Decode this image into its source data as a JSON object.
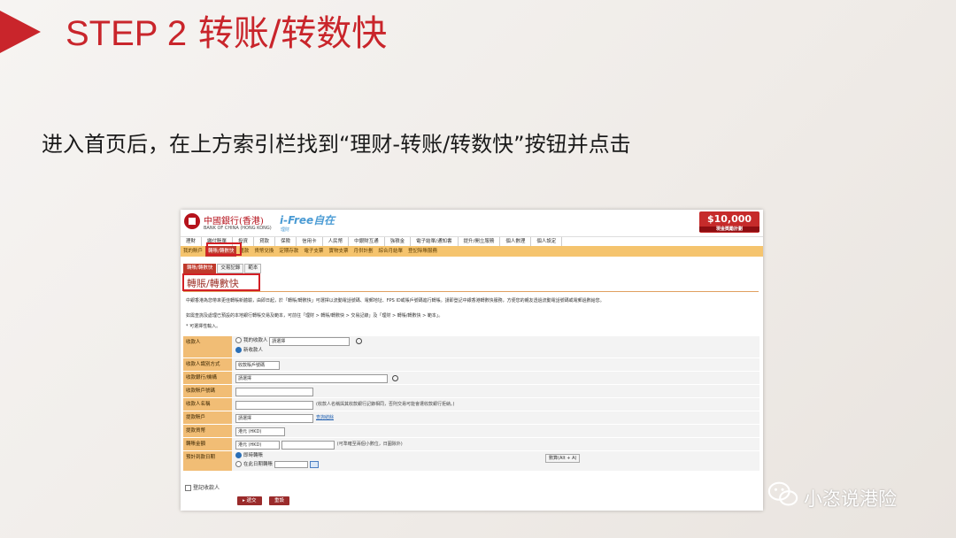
{
  "slide": {
    "step_label": "STEP 2",
    "step_title": "转账/转数快",
    "subtitle": "进入首页后，在上方索引栏找到“理财-转账/转数快”按钮并点击",
    "watermark": "小恣说港险"
  },
  "header": {
    "bank_name_cn": "中國銀行(香港)",
    "bank_name_en": "BANK OF CHINA (HONG KONG)",
    "ifree": "i-Free自在",
    "ifree_sub": "理財",
    "promo": "$10,000",
    "promo_sub": "現金獎勵計劃"
  },
  "nav_top": [
    "理財",
    "繳付賬單",
    "投資",
    "貸款",
    "保險",
    "信用卡",
    "人民幣",
    "中銀財互通",
    "強積金",
    "電子結單/通知書",
    "提升/開立服務",
    "個人數理",
    "個人設定"
  ],
  "nav_sub": [
    {
      "label": "我的賬戶",
      "selected": false
    },
    {
      "label": "轉賬/轉數快",
      "selected": true
    },
    {
      "label": "匯款",
      "selected": false
    },
    {
      "label": "貨幣兌換",
      "selected": false
    },
    {
      "label": "定期存款",
      "selected": false
    },
    {
      "label": "電子支票",
      "selected": false
    },
    {
      "label": "實物支票",
      "selected": false
    },
    {
      "label": "月供計劃",
      "selected": false
    },
    {
      "label": "綜合月結單",
      "selected": false
    },
    {
      "label": "登記除賬服務",
      "selected": false
    }
  ],
  "tabs": [
    {
      "label": "轉賬/轉數快",
      "selected": true
    },
    {
      "label": "交易記錄",
      "selected": false
    },
    {
      "label": "範本",
      "selected": false
    }
  ],
  "page_title": "轉賬/轉數快",
  "info": {
    "line1": "中銀香港為您帶來更佳轉賬新體驗，由即日起，於「轉賬/轉數快」可選擇以流動電話號碼、電郵地址、FPS ID或賬戶號碼進行轉賬。請即登記中銀香港轉數快服務，方便您的親友透過流動電話號碼或電郵過數給您。",
    "line2": "如需查詢及處理已預設的本地銀行轉賬交易及範本，可前往「理財 > 轉賬/轉數快 > 交易記錄」及「理財 > 轉賬/轉數快 > 範本」。",
    "required": "* 可選擇性輸入。"
  },
  "form": {
    "payee_label": "收款人",
    "payee_opt1": "我的收款人",
    "payee_opt2": "新收款人",
    "select_placeholder": "請選擇",
    "id_type_label": "收款人識別方式",
    "id_type_value": "收款賬戶號碼",
    "bank_label": "收款銀行/機構",
    "account_label": "收款賬戶號碼",
    "name_label": "收款人名稱",
    "name_note": "(收款人名稱與其收款銀行記錄相同，否則交易可能會遭收款銀行拒納。)",
    "from_label": "提款賬戶",
    "from_link": "查詢結餘",
    "currency_label": "提款貨幣",
    "currency_value": "港元 (HKD)",
    "amount_label": "轉賬金額",
    "amount_currency": "港元 (HKD)",
    "amount_note": "(可準確至兩個小數位，日圓除外)",
    "date_label": "預計到款日期",
    "date_opt1": "即時轉賬",
    "date_opt2": "在此日期轉賬",
    "calc": "數算(Alt + A)",
    "save_payee": "登記收款人",
    "submit": "遞交",
    "reset": "重設"
  },
  "colors": {
    "accent": "#c9252b",
    "nav_orange": "#f5c46e",
    "label_orange": "#f1bd75"
  }
}
